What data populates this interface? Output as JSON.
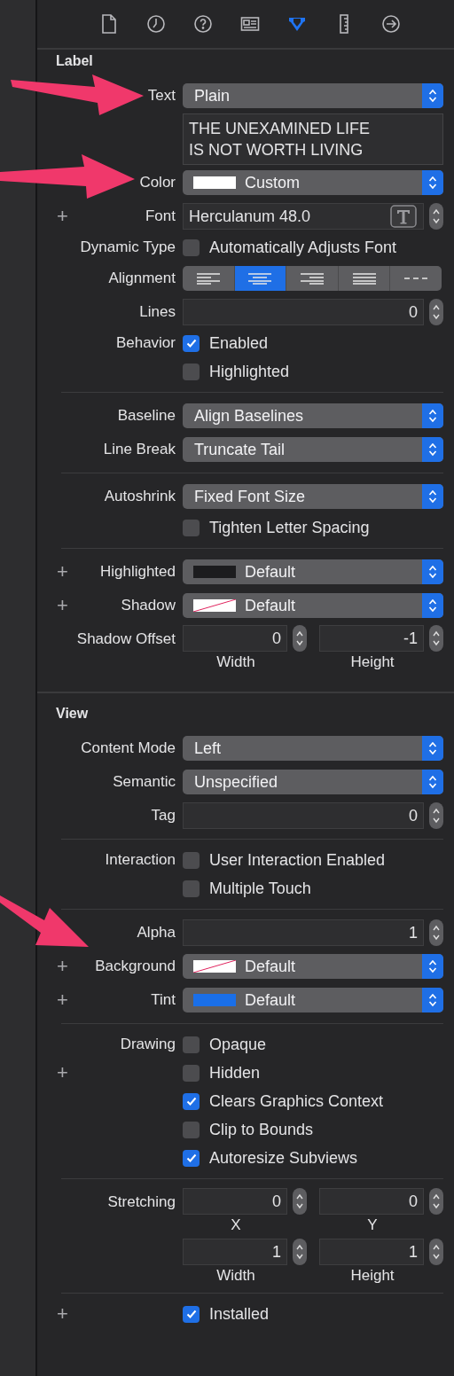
{
  "toolbar": [
    {
      "kind": "file",
      "selected": false
    },
    {
      "kind": "history",
      "selected": false
    },
    {
      "kind": "help",
      "selected": false
    },
    {
      "kind": "identity",
      "selected": false
    },
    {
      "kind": "attributes",
      "selected": true
    },
    {
      "kind": "size",
      "selected": false
    },
    {
      "kind": "connections",
      "selected": false
    }
  ],
  "sections": [
    {
      "title": "Label",
      "groups": [
        {
          "rows": [
            {
              "kind": "popup",
              "label": "Text",
              "value": "Plain"
            },
            {
              "kind": "textarea",
              "value": "THE UNEXAMINED LIFE IS NOT WORTH LIVING"
            },
            {
              "kind": "popup",
              "label": "Color",
              "value": "Custom",
              "swatch": {
                "kind": "color",
                "color": "#ffffff"
              }
            },
            {
              "kind": "font",
              "add": "+",
              "label": "Font",
              "value": "Herculanum 48.0"
            },
            {
              "kind": "checkbox",
              "label": "Dynamic Type",
              "text": "Automatically Adjusts Font",
              "checked": false
            },
            {
              "kind": "segmented",
              "label": "Alignment",
              "segments": [
                {
                  "kind": "left",
                  "selected": false
                },
                {
                  "kind": "center",
                  "selected": true
                },
                {
                  "kind": "right",
                  "selected": false
                },
                {
                  "kind": "justified",
                  "selected": false
                },
                {
                  "kind": "natural",
                  "selected": false
                }
              ]
            },
            {
              "kind": "stepper",
              "label": "Lines",
              "value": "0"
            },
            {
              "kind": "checkbox",
              "label": "Behavior",
              "text": "Enabled",
              "checked": true
            },
            {
              "kind": "checkbox",
              "text": "Highlighted",
              "checked": false
            }
          ]
        },
        {
          "rows": [
            {
              "kind": "popup",
              "label": "Baseline",
              "value": "Align Baselines"
            },
            {
              "kind": "popup",
              "label": "Line Break",
              "value": "Truncate Tail"
            }
          ]
        },
        {
          "rows": [
            {
              "kind": "popup",
              "label": "Autoshrink",
              "value": "Fixed Font Size"
            },
            {
              "kind": "checkbox",
              "text": "Tighten Letter Spacing",
              "checked": false
            }
          ]
        },
        {
          "rows": [
            {
              "kind": "popup",
              "add": "+",
              "label": "Highlighted",
              "value": "Default",
              "swatch": {
                "kind": "color",
                "color": "#1c1c1e"
              }
            },
            {
              "kind": "popup",
              "add": "+",
              "label": "Shadow",
              "value": "Default",
              "swatch": {
                "kind": "none"
              }
            },
            {
              "kind": "pair",
              "label": "Shadow Offset",
              "fields": [
                {
                  "value": "0",
                  "caption": "Width"
                },
                {
                  "value": "-1",
                  "caption": "Height"
                }
              ]
            }
          ]
        }
      ]
    },
    {
      "title": "View",
      "groups": [
        {
          "rows": [
            {
              "kind": "popup",
              "label": "Content Mode",
              "value": "Left"
            },
            {
              "kind": "popup",
              "label": "Semantic",
              "value": "Unspecified"
            },
            {
              "kind": "stepper",
              "label": "Tag",
              "value": "0"
            }
          ]
        },
        {
          "rows": [
            {
              "kind": "checkbox",
              "label": "Interaction",
              "text": "User Interaction Enabled",
              "checked": false
            },
            {
              "kind": "checkbox",
              "text": "Multiple Touch",
              "checked": false
            }
          ]
        },
        {
          "rows": [
            {
              "kind": "stepper",
              "label": "Alpha",
              "value": "1"
            },
            {
              "kind": "popup",
              "add": "+",
              "label": "Background",
              "value": "Default",
              "swatch": {
                "kind": "none"
              }
            },
            {
              "kind": "popup",
              "add": "+",
              "label": "Tint",
              "value": "Default",
              "swatch": {
                "kind": "color",
                "color": "#1a6fe8"
              }
            }
          ]
        },
        {
          "rows": [
            {
              "kind": "checkbox",
              "label": "Drawing",
              "text": "Opaque",
              "checked": false
            },
            {
              "kind": "checkbox",
              "add": "+",
              "text": "Hidden",
              "checked": false
            },
            {
              "kind": "checkbox",
              "text": "Clears Graphics Context",
              "checked": true
            },
            {
              "kind": "checkbox",
              "text": "Clip to Bounds",
              "checked": false
            },
            {
              "kind": "checkbox",
              "text": "Autoresize Subviews",
              "checked": true
            }
          ]
        },
        {
          "rows": [
            {
              "kind": "pair",
              "label": "Stretching",
              "fields": [
                {
                  "value": "0",
                  "caption": "X"
                },
                {
                  "value": "0",
                  "caption": "Y"
                }
              ]
            },
            {
              "kind": "pair",
              "fields": [
                {
                  "value": "1",
                  "caption": "Width"
                },
                {
                  "value": "1",
                  "caption": "Height"
                }
              ]
            }
          ]
        },
        {
          "rows": [
            {
              "kind": "checkbox",
              "add": "+",
              "text": "Installed",
              "checked": true
            }
          ]
        }
      ]
    }
  ]
}
